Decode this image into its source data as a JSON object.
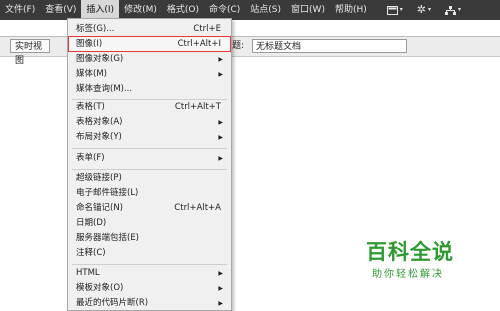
{
  "menubar": {
    "items": [
      "文件(F)",
      "查看(V)",
      "插入(I)",
      "修改(M)",
      "格式(O)",
      "命令(C)",
      "站点(S)",
      "窗口(W)",
      "帮助(H)"
    ],
    "active_index": 2,
    "tool_icons": [
      "layout-icon",
      "gear-icon",
      "sitemap-icon"
    ]
  },
  "toolbar": {
    "live_view_label": "实时视图",
    "title_label": "题:",
    "title_value": "无标题文档"
  },
  "dropdown": {
    "items": [
      {
        "label": "标签(G)...",
        "shortcut": "Ctrl+E"
      },
      {
        "label": "图像(I)",
        "shortcut": "Ctrl+Alt+I",
        "highlighted": true
      },
      {
        "label": "图像对象(G)",
        "submenu": true
      },
      {
        "label": "媒体(M)",
        "submenu": true
      },
      {
        "label": "媒体查询(M)..."
      },
      {
        "label": "表格(T)",
        "shortcut": "Ctrl+Alt+T"
      },
      {
        "label": "表格对象(A)",
        "submenu": true
      },
      {
        "label": "布局对象(Y)",
        "submenu": true
      },
      {
        "label": "表单(F)",
        "submenu": true
      },
      {
        "label": "超级链接(P)"
      },
      {
        "label": "电子邮件链接(L)"
      },
      {
        "label": "命名锚记(N)",
        "shortcut": "Ctrl+Alt+A"
      },
      {
        "label": "日期(D)"
      },
      {
        "label": "服务器端包括(E)"
      },
      {
        "label": "注释(C)"
      },
      {
        "label": "HTML",
        "submenu": true
      },
      {
        "label": "模板对象(O)",
        "submenu": true
      },
      {
        "label": "最近的代码片断(R)",
        "submenu": true
      }
    ],
    "submenu_glyph": "▶"
  },
  "watermark": {
    "title": "百科全说",
    "subtitle": "助你轻松解决",
    "color": "#2f9a32"
  }
}
